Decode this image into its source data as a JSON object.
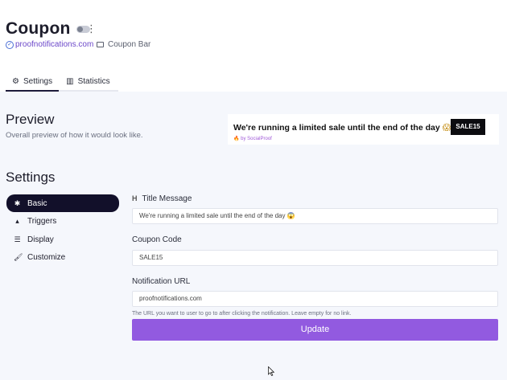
{
  "header": {
    "title": "Coupon",
    "domain": "proofnotifications.com",
    "notification_type": "Coupon Bar"
  },
  "tabs": [
    {
      "label": "Settings",
      "icon": "gears-icon",
      "active": true
    },
    {
      "label": "Statistics",
      "icon": "chart-icon",
      "active": false
    }
  ],
  "preview": {
    "heading": "Preview",
    "subheading": "Overall preview of how it would look like.",
    "notification_text": "We're running a limited sale until the end of the day",
    "notification_emoji": "😱",
    "notification_by": "🔥 by SocialProof",
    "coupon_code": "SALE15"
  },
  "settings": {
    "heading": "Settings",
    "menu": [
      {
        "label": "Basic",
        "icon": "gear-icon",
        "active": true
      },
      {
        "label": "Triggers",
        "icon": "chevron-up-icon",
        "active": false
      },
      {
        "label": "Display",
        "icon": "bars-icon",
        "active": false
      },
      {
        "label": "Customize",
        "icon": "brush-icon",
        "active": false
      }
    ]
  },
  "form": {
    "title_label": "Title Message",
    "title_value": "We're running a limited sale until the end of the day 😱",
    "coupon_label": "Coupon Code",
    "coupon_value": "SALE15",
    "url_label": "Notification URL",
    "url_value": "proofnotifications.com",
    "url_help": "The URL you want to user to go to after clicking the notification. Leave empty for no link.",
    "submit_label": "Update"
  },
  "colors": {
    "accent": "#925ae0",
    "dark": "#12102a",
    "background": "#f5f7fc"
  }
}
